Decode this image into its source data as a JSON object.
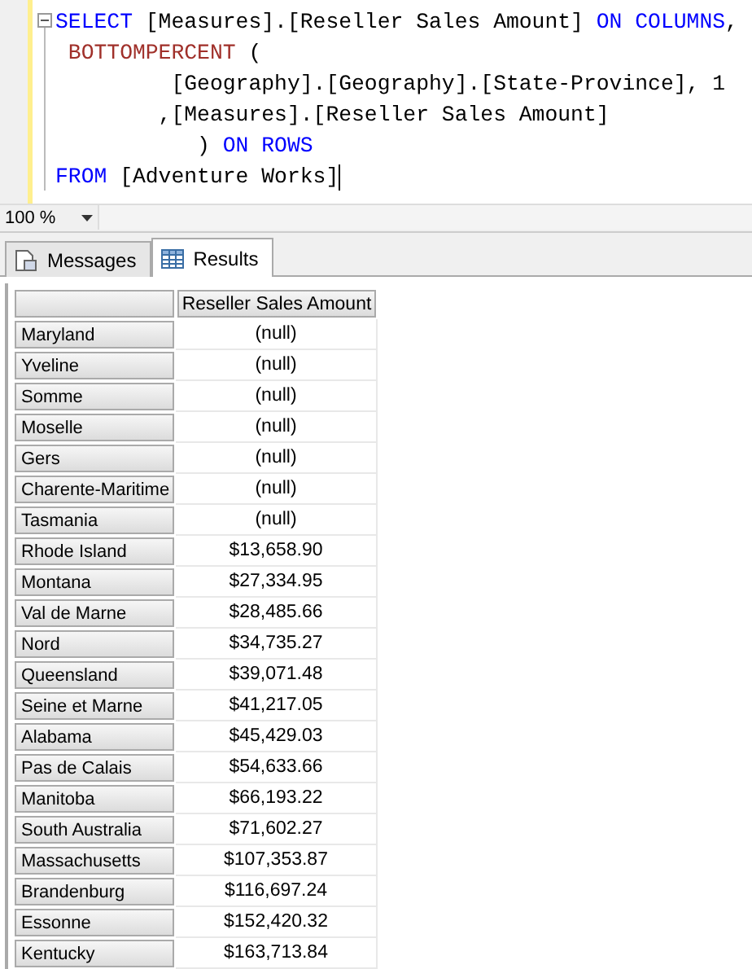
{
  "editor": {
    "lines": [
      [
        {
          "kind": "keyword",
          "text": "SELECT"
        },
        {
          "kind": "plain",
          "text": " [Measures].[Reseller Sales Amount] "
        },
        {
          "kind": "keyword",
          "text": "ON COLUMNS"
        },
        {
          "kind": "plain",
          "text": ","
        }
      ],
      [
        {
          "kind": "function",
          "text": " BOTTOMPERCENT"
        },
        {
          "kind": "plain",
          "text": " ("
        }
      ],
      [
        {
          "kind": "plain",
          "text": "         [Geography].[Geography].[State-Province], 1"
        }
      ],
      [
        {
          "kind": "plain",
          "text": "        ,[Measures].[Reseller Sales Amount]"
        }
      ],
      [
        {
          "kind": "plain",
          "text": "           ) "
        },
        {
          "kind": "keyword",
          "text": "ON ROWS"
        }
      ],
      [
        {
          "kind": "keyword",
          "text": "FROM"
        },
        {
          "kind": "plain",
          "text": " [Adventure Works]"
        }
      ]
    ]
  },
  "zoom": {
    "value": "100 %"
  },
  "tabs": [
    {
      "label": "Messages",
      "kind": "messages",
      "selected": false
    },
    {
      "label": "Results",
      "kind": "results",
      "selected": true
    }
  ],
  "table": {
    "columns": [
      "Reseller Sales Amount"
    ],
    "rows": [
      {
        "label": "Maryland",
        "value": "(null)"
      },
      {
        "label": "Yveline",
        "value": "(null)"
      },
      {
        "label": "Somme",
        "value": "(null)"
      },
      {
        "label": "Moselle",
        "value": "(null)"
      },
      {
        "label": "Gers",
        "value": "(null)"
      },
      {
        "label": "Charente-Maritime",
        "value": "(null)"
      },
      {
        "label": "Tasmania",
        "value": "(null)"
      },
      {
        "label": "Rhode Island",
        "value": "$13,658.90"
      },
      {
        "label": "Montana",
        "value": "$27,334.95"
      },
      {
        "label": "Val de Marne",
        "value": "$28,485.66"
      },
      {
        "label": "Nord",
        "value": "$34,735.27"
      },
      {
        "label": "Queensland",
        "value": "$39,071.48"
      },
      {
        "label": "Seine et Marne",
        "value": "$41,217.05"
      },
      {
        "label": "Alabama",
        "value": "$45,429.03"
      },
      {
        "label": "Pas de Calais",
        "value": "$54,633.66"
      },
      {
        "label": "Manitoba",
        "value": "$66,193.22"
      },
      {
        "label": "South Australia",
        "value": "$71,602.27"
      },
      {
        "label": "Massachusetts",
        "value": "$107,353.87"
      },
      {
        "label": "Brandenburg",
        "value": "$116,697.24"
      },
      {
        "label": "Essonne",
        "value": "$152,420.32"
      },
      {
        "label": "Kentucky",
        "value": "$163,713.84"
      }
    ]
  }
}
